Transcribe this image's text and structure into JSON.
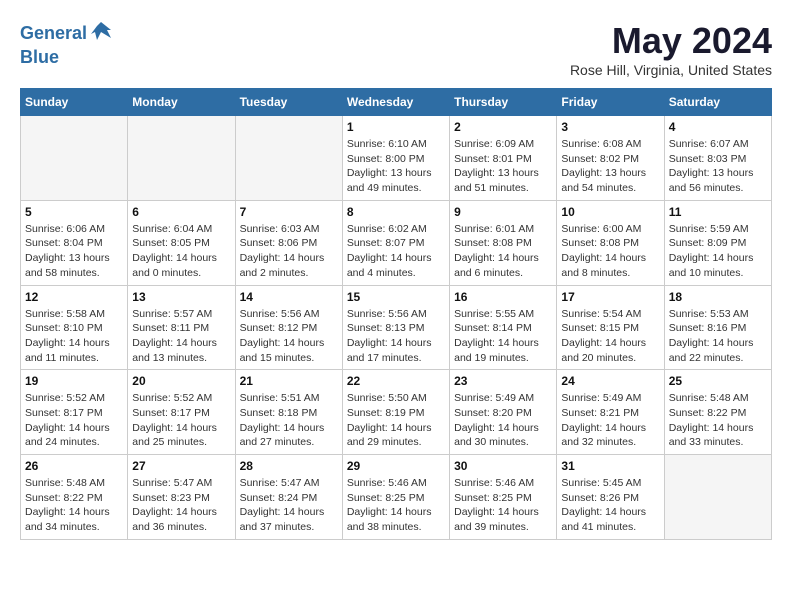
{
  "header": {
    "logo_line1": "General",
    "logo_line2": "Blue",
    "month_title": "May 2024",
    "location": "Rose Hill, Virginia, United States"
  },
  "days_of_week": [
    "Sunday",
    "Monday",
    "Tuesday",
    "Wednesday",
    "Thursday",
    "Friday",
    "Saturday"
  ],
  "weeks": [
    [
      {
        "day": "",
        "info": ""
      },
      {
        "day": "",
        "info": ""
      },
      {
        "day": "",
        "info": ""
      },
      {
        "day": "1",
        "info": "Sunrise: 6:10 AM\nSunset: 8:00 PM\nDaylight: 13 hours\nand 49 minutes."
      },
      {
        "day": "2",
        "info": "Sunrise: 6:09 AM\nSunset: 8:01 PM\nDaylight: 13 hours\nand 51 minutes."
      },
      {
        "day": "3",
        "info": "Sunrise: 6:08 AM\nSunset: 8:02 PM\nDaylight: 13 hours\nand 54 minutes."
      },
      {
        "day": "4",
        "info": "Sunrise: 6:07 AM\nSunset: 8:03 PM\nDaylight: 13 hours\nand 56 minutes."
      }
    ],
    [
      {
        "day": "5",
        "info": "Sunrise: 6:06 AM\nSunset: 8:04 PM\nDaylight: 13 hours\nand 58 minutes."
      },
      {
        "day": "6",
        "info": "Sunrise: 6:04 AM\nSunset: 8:05 PM\nDaylight: 14 hours\nand 0 minutes."
      },
      {
        "day": "7",
        "info": "Sunrise: 6:03 AM\nSunset: 8:06 PM\nDaylight: 14 hours\nand 2 minutes."
      },
      {
        "day": "8",
        "info": "Sunrise: 6:02 AM\nSunset: 8:07 PM\nDaylight: 14 hours\nand 4 minutes."
      },
      {
        "day": "9",
        "info": "Sunrise: 6:01 AM\nSunset: 8:08 PM\nDaylight: 14 hours\nand 6 minutes."
      },
      {
        "day": "10",
        "info": "Sunrise: 6:00 AM\nSunset: 8:08 PM\nDaylight: 14 hours\nand 8 minutes."
      },
      {
        "day": "11",
        "info": "Sunrise: 5:59 AM\nSunset: 8:09 PM\nDaylight: 14 hours\nand 10 minutes."
      }
    ],
    [
      {
        "day": "12",
        "info": "Sunrise: 5:58 AM\nSunset: 8:10 PM\nDaylight: 14 hours\nand 11 minutes."
      },
      {
        "day": "13",
        "info": "Sunrise: 5:57 AM\nSunset: 8:11 PM\nDaylight: 14 hours\nand 13 minutes."
      },
      {
        "day": "14",
        "info": "Sunrise: 5:56 AM\nSunset: 8:12 PM\nDaylight: 14 hours\nand 15 minutes."
      },
      {
        "day": "15",
        "info": "Sunrise: 5:56 AM\nSunset: 8:13 PM\nDaylight: 14 hours\nand 17 minutes."
      },
      {
        "day": "16",
        "info": "Sunrise: 5:55 AM\nSunset: 8:14 PM\nDaylight: 14 hours\nand 19 minutes."
      },
      {
        "day": "17",
        "info": "Sunrise: 5:54 AM\nSunset: 8:15 PM\nDaylight: 14 hours\nand 20 minutes."
      },
      {
        "day": "18",
        "info": "Sunrise: 5:53 AM\nSunset: 8:16 PM\nDaylight: 14 hours\nand 22 minutes."
      }
    ],
    [
      {
        "day": "19",
        "info": "Sunrise: 5:52 AM\nSunset: 8:17 PM\nDaylight: 14 hours\nand 24 minutes."
      },
      {
        "day": "20",
        "info": "Sunrise: 5:52 AM\nSunset: 8:17 PM\nDaylight: 14 hours\nand 25 minutes."
      },
      {
        "day": "21",
        "info": "Sunrise: 5:51 AM\nSunset: 8:18 PM\nDaylight: 14 hours\nand 27 minutes."
      },
      {
        "day": "22",
        "info": "Sunrise: 5:50 AM\nSunset: 8:19 PM\nDaylight: 14 hours\nand 29 minutes."
      },
      {
        "day": "23",
        "info": "Sunrise: 5:49 AM\nSunset: 8:20 PM\nDaylight: 14 hours\nand 30 minutes."
      },
      {
        "day": "24",
        "info": "Sunrise: 5:49 AM\nSunset: 8:21 PM\nDaylight: 14 hours\nand 32 minutes."
      },
      {
        "day": "25",
        "info": "Sunrise: 5:48 AM\nSunset: 8:22 PM\nDaylight: 14 hours\nand 33 minutes."
      }
    ],
    [
      {
        "day": "26",
        "info": "Sunrise: 5:48 AM\nSunset: 8:22 PM\nDaylight: 14 hours\nand 34 minutes."
      },
      {
        "day": "27",
        "info": "Sunrise: 5:47 AM\nSunset: 8:23 PM\nDaylight: 14 hours\nand 36 minutes."
      },
      {
        "day": "28",
        "info": "Sunrise: 5:47 AM\nSunset: 8:24 PM\nDaylight: 14 hours\nand 37 minutes."
      },
      {
        "day": "29",
        "info": "Sunrise: 5:46 AM\nSunset: 8:25 PM\nDaylight: 14 hours\nand 38 minutes."
      },
      {
        "day": "30",
        "info": "Sunrise: 5:46 AM\nSunset: 8:25 PM\nDaylight: 14 hours\nand 39 minutes."
      },
      {
        "day": "31",
        "info": "Sunrise: 5:45 AM\nSunset: 8:26 PM\nDaylight: 14 hours\nand 41 minutes."
      },
      {
        "day": "",
        "info": ""
      }
    ]
  ]
}
